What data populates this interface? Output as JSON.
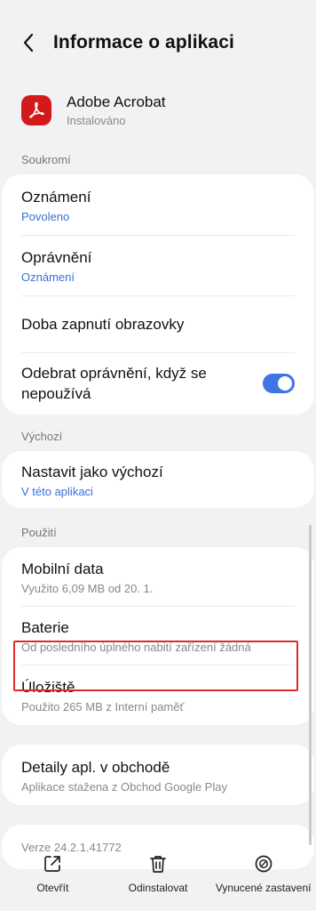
{
  "header": {
    "title": "Informace o aplikaci"
  },
  "app": {
    "name": "Adobe Acrobat",
    "status": "Instalováno",
    "icon": "acrobat-icon",
    "color": "#d4191c"
  },
  "sections": {
    "privacy": {
      "label": "Soukromí",
      "notifications": {
        "title": "Oznámení",
        "value": "Povoleno"
      },
      "permissions": {
        "title": "Oprávnění",
        "value": "Oznámení"
      },
      "screen_time": {
        "title": "Doba zapnutí obrazovky"
      },
      "remove_permissions": {
        "title": "Odebrat oprávnění, když se nepoužívá",
        "toggle_on": true
      }
    },
    "defaults": {
      "label": "Výchozí",
      "set_default": {
        "title": "Nastavit jako výchozí",
        "value": "V této aplikaci"
      }
    },
    "usage": {
      "label": "Použití",
      "mobile_data": {
        "title": "Mobilní data",
        "value": "Využito 6,09 MB od 20. 1."
      },
      "battery": {
        "title": "Baterie",
        "value": "Od posledního úplného nabití zařízení žádná"
      },
      "storage": {
        "title": "Úložiště",
        "value": "Použito 265 MB z Interní paměť"
      }
    },
    "store": {
      "details": {
        "title": "Detaily apl. v obchodě",
        "value": "Aplikace stažena z Obchod Google Play"
      }
    },
    "version": {
      "text": "Verze 24.2.1.41772"
    }
  },
  "bottom_bar": {
    "open": {
      "label": "Otevřít",
      "icon": "open-external-icon"
    },
    "uninstall": {
      "label": "Odinstalovat",
      "icon": "trash-icon"
    },
    "force_stop": {
      "label": "Vynucené zastavení",
      "icon": "stop-circle-icon"
    }
  },
  "colors": {
    "accent": "#3f73e6",
    "highlight": "#e02a2a",
    "background": "#f2f2f4"
  }
}
